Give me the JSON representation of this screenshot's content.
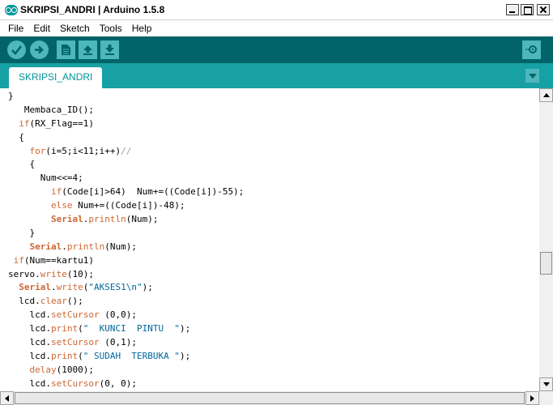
{
  "window": {
    "title": "SKRIPSI_ANDRI | Arduino 1.5.8"
  },
  "menu": [
    "File",
    "Edit",
    "Sketch",
    "Tools",
    "Help"
  ],
  "toolbar": {
    "buttons": [
      "verify-icon",
      "upload-icon",
      "new-icon",
      "open-icon",
      "save-icon"
    ],
    "right_button": "serial-monitor-icon"
  },
  "tabs": [
    "SKRIPSI_ANDRI"
  ],
  "colors": {
    "toolbar_bg": "#006468",
    "tabstrip_bg": "#17a1a5",
    "button_bg": "#4db7bb",
    "keyword": "#cc6633",
    "string": "#006699",
    "comment": "#95a5a6"
  },
  "code_lines": [
    [
      {
        "t": "}"
      }
    ],
    [
      {
        "t": "   Membaca_ID();"
      }
    ],
    [
      {
        "t": "  "
      },
      {
        "t": "if",
        "c": "kw"
      },
      {
        "t": "(RX_Flag==1)"
      }
    ],
    [
      {
        "t": "  {"
      }
    ],
    [
      {
        "t": "    "
      },
      {
        "t": "for",
        "c": "kw"
      },
      {
        "t": "(i=5;i<11;i++)"
      },
      {
        "t": "//",
        "c": "cm"
      }
    ],
    [
      {
        "t": "    {"
      }
    ],
    [
      {
        "t": "      Num<<=4;"
      }
    ],
    [
      {
        "t": "        "
      },
      {
        "t": "if",
        "c": "kw"
      },
      {
        "t": "(Code[i]>64)  Num+=((Code[i])-55);"
      }
    ],
    [
      {
        "t": "        "
      },
      {
        "t": "else",
        "c": "kw"
      },
      {
        "t": " Num+=((Code[i])-48);"
      }
    ],
    [
      {
        "t": "        "
      },
      {
        "t": "Serial",
        "c": "cls"
      },
      {
        "t": "."
      },
      {
        "t": "println",
        "c": "fn"
      },
      {
        "t": "(Num);"
      }
    ],
    [
      {
        "t": "    }"
      }
    ],
    [
      {
        "t": "    "
      },
      {
        "t": "Serial",
        "c": "cls"
      },
      {
        "t": "."
      },
      {
        "t": "println",
        "c": "fn"
      },
      {
        "t": "(Num);"
      }
    ],
    [
      {
        "t": " "
      },
      {
        "t": "if",
        "c": "kw"
      },
      {
        "t": "(Num==kartu1)"
      }
    ],
    [
      {
        "t": "servo."
      },
      {
        "t": "write",
        "c": "fn"
      },
      {
        "t": "(10);"
      }
    ],
    [
      {
        "t": "  "
      },
      {
        "t": "Serial",
        "c": "cls"
      },
      {
        "t": "."
      },
      {
        "t": "write",
        "c": "fn"
      },
      {
        "t": "("
      },
      {
        "t": "\"AKSES1\\n\"",
        "c": "str"
      },
      {
        "t": ");"
      }
    ],
    [
      {
        "t": "  lcd."
      },
      {
        "t": "clear",
        "c": "fn"
      },
      {
        "t": "();"
      }
    ],
    [
      {
        "t": "    lcd."
      },
      {
        "t": "setCursor",
        "c": "fn"
      },
      {
        "t": " (0,0);"
      }
    ],
    [
      {
        "t": "    lcd."
      },
      {
        "t": "print",
        "c": "fn"
      },
      {
        "t": "("
      },
      {
        "t": "\"  KUNCI  PINTU  \"",
        "c": "str"
      },
      {
        "t": ");"
      }
    ],
    [
      {
        "t": "    lcd."
      },
      {
        "t": "setCursor",
        "c": "fn"
      },
      {
        "t": " (0,1);"
      }
    ],
    [
      {
        "t": "    lcd."
      },
      {
        "t": "print",
        "c": "fn"
      },
      {
        "t": "("
      },
      {
        "t": "\" SUDAH  TERBUKA \"",
        "c": "str"
      },
      {
        "t": ");"
      }
    ],
    [
      {
        "t": "    "
      },
      {
        "t": "delay",
        "c": "fn"
      },
      {
        "t": "(1000);"
      }
    ],
    [
      {
        "t": "    lcd."
      },
      {
        "t": "setCursor",
        "c": "fn"
      },
      {
        "t": "(0, 0);"
      }
    ]
  ]
}
